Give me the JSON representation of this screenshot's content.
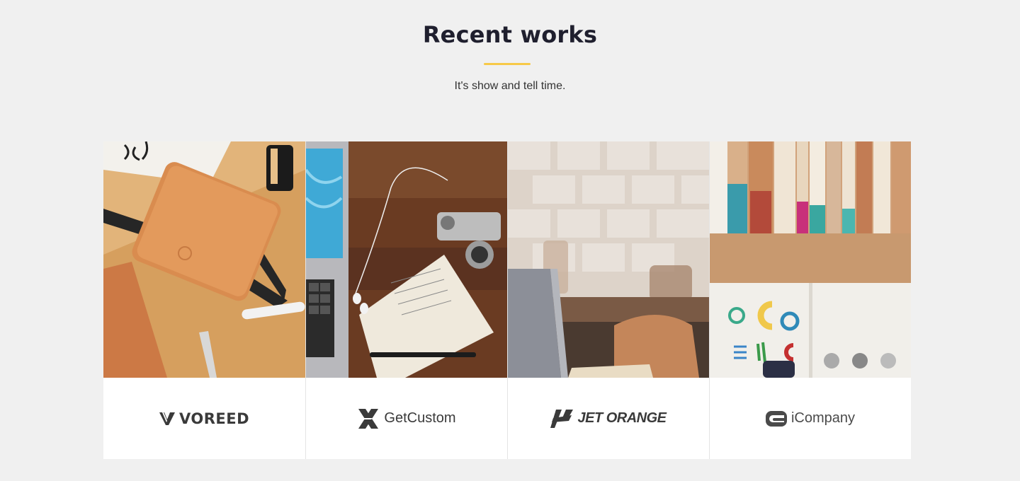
{
  "section": {
    "title": "Recent works",
    "subtitle": "It's show and tell time.",
    "accent_color": "#f7c948"
  },
  "works": [
    {
      "logo_text": "VOREED",
      "logo_icon": "voreed-v-icon",
      "photo": "notebook-on-desk-photo"
    },
    {
      "logo_text": "GetCustom",
      "logo_icon": "getcustom-x-icon",
      "photo": "laptop-notebook-camera-photo"
    },
    {
      "logo_text": "JET ORANGE",
      "logo_icon": "jetorange-wing-icon",
      "photo": "blurred-cafe-photo"
    },
    {
      "logo_text": "iCompany",
      "logo_icon": "icompany-clip-icon",
      "photo": "bookshelf-logos-photo"
    }
  ]
}
